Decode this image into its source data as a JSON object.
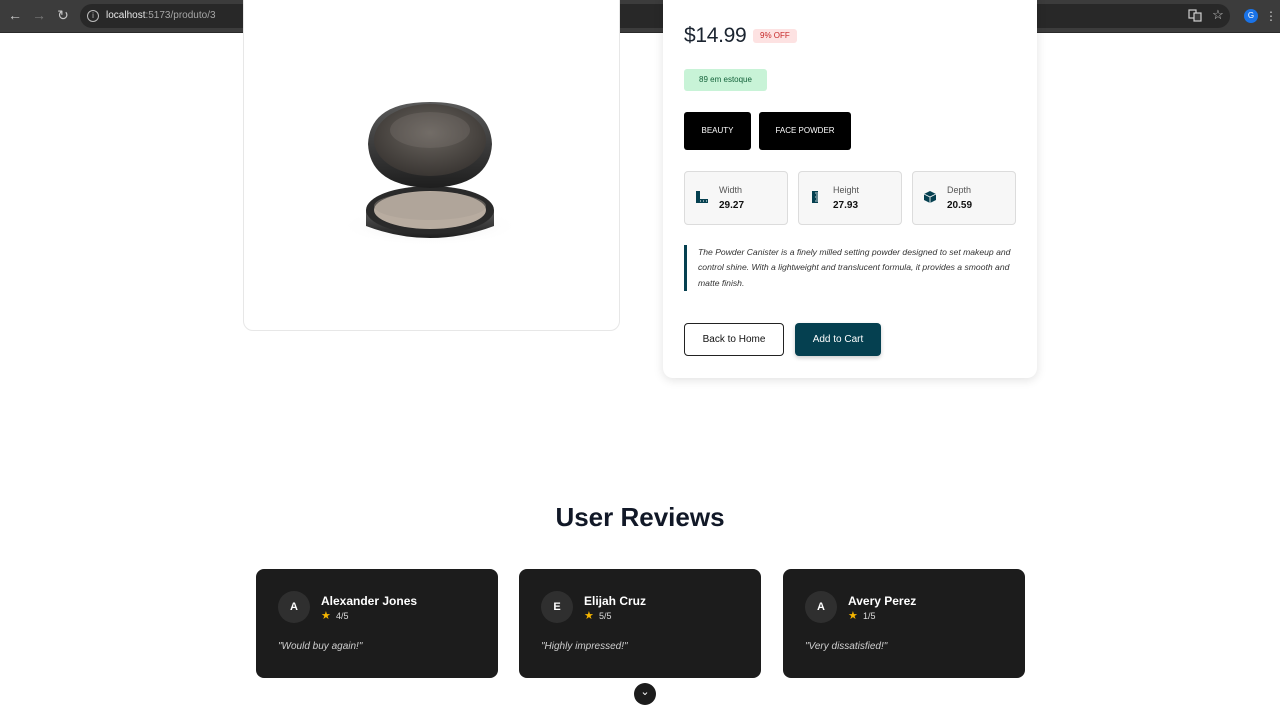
{
  "browser": {
    "url_host": "localhost",
    "url_path": ":5173/produto/3",
    "profile_initial": "G"
  },
  "product": {
    "price": "$14.99",
    "discount": "9% OFF",
    "stock": "89 em estoque",
    "tags": [
      "BEAUTY",
      "FACE POWDER"
    ],
    "dimensions": [
      {
        "label": "Width",
        "value": "29.27",
        "icon": "ruler-icon"
      },
      {
        "label": "Height",
        "value": "27.93",
        "icon": "ruler-vertical-icon"
      },
      {
        "label": "Depth",
        "value": "20.59",
        "icon": "box-icon"
      }
    ],
    "description": "The Powder Canister is a finely milled setting powder designed to set makeup and control shine. With a lightweight and translucent formula, it provides a smooth and matte finish.",
    "back_label": "Back to Home",
    "cart_label": "Add to Cart"
  },
  "reviews": {
    "title": "User Reviews",
    "items": [
      {
        "initial": "A",
        "name": "Alexander Jones",
        "rating": "4/5",
        "comment": "\"Would buy again!\""
      },
      {
        "initial": "E",
        "name": "Elijah Cruz",
        "rating": "5/5",
        "comment": "\"Highly impressed!\""
      },
      {
        "initial": "A",
        "name": "Avery Perez",
        "rating": "1/5",
        "comment": "\"Very dissatisfied!\""
      }
    ]
  },
  "colors": {
    "accent": "#054050",
    "stock_bg": "#c8f3d7",
    "discount_bg": "#fde2e2",
    "review_card_bg": "#1c1c1c"
  }
}
